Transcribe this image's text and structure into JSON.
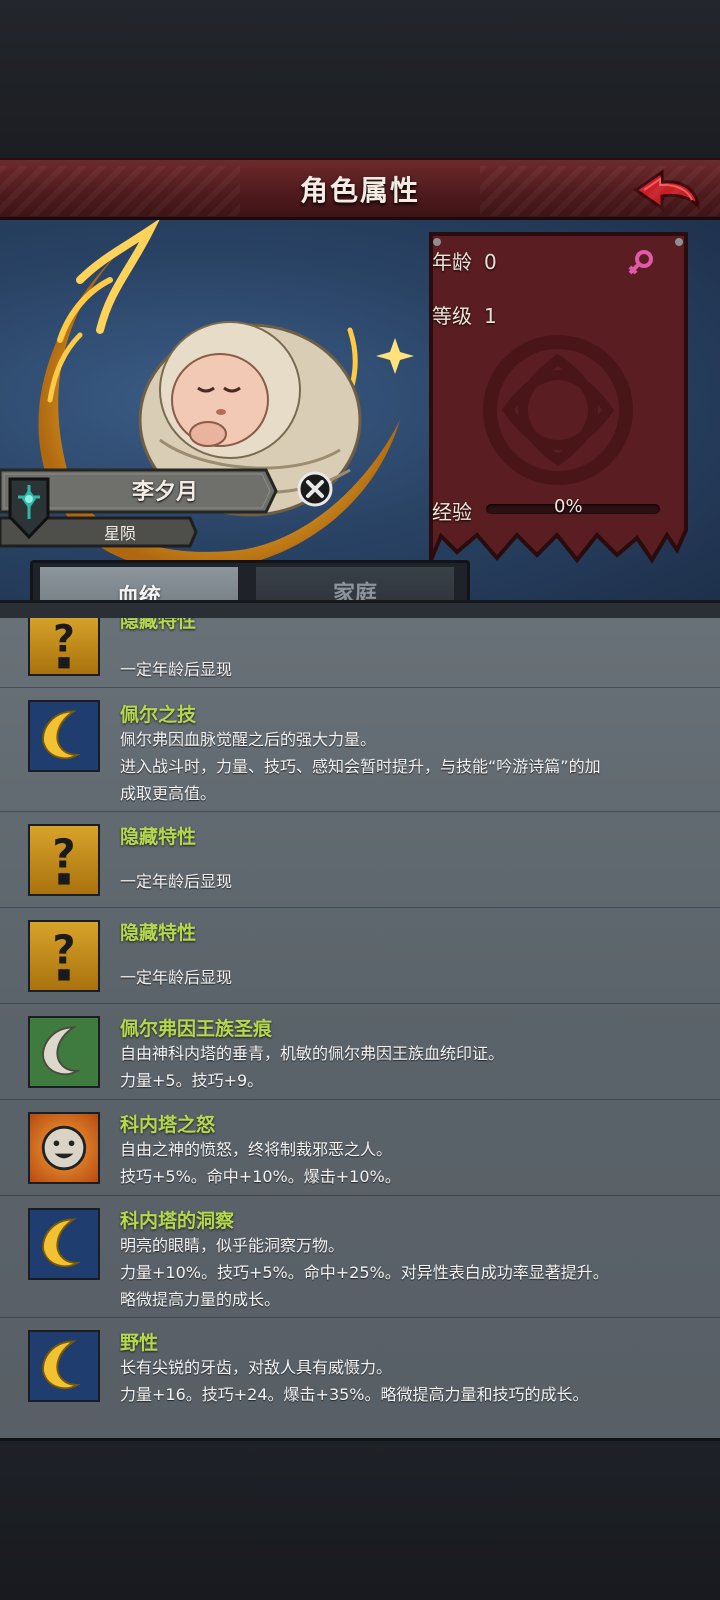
{
  "header": {
    "title": "角色属性"
  },
  "character": {
    "name": "李夕月",
    "title": "星陨",
    "age_label": "年龄",
    "age_value": "0",
    "level_label": "等级",
    "level_value": "1",
    "exp_label": "经验",
    "exp_value": "0%",
    "exp_fraction": 0.0
  },
  "tabs": [
    {
      "label": "血统",
      "active": true
    },
    {
      "label": "家庭",
      "active": false
    }
  ],
  "traits": [
    {
      "icon": "question-icon",
      "name": "隐藏特性",
      "lines": [
        "",
        "一定年龄后显现"
      ]
    },
    {
      "icon": "crescent-moon-icon",
      "name": "佩尔之技",
      "lines": [
        "佩尔弗因血脉觉醒之后的强大力量。",
        "进入战斗时，力量、技巧、感知会暂时提升，与技能“吟游诗篇”的加",
        "成取更高值。"
      ]
    },
    {
      "icon": "question-icon",
      "name": "隐藏特性",
      "lines": [
        "",
        "一定年龄后显现"
      ]
    },
    {
      "icon": "question-icon",
      "name": "隐藏特性",
      "lines": [
        "",
        "一定年龄后显现"
      ]
    },
    {
      "icon": "green-crescent-icon",
      "name": "佩尔弗因王族圣痕",
      "lines": [
        "自由神科内塔的垂青，机敏的佩尔弗因王族血统印证。",
        "力量+5。技巧+9。"
      ]
    },
    {
      "icon": "smiling-sun-icon",
      "name": "科内塔之怒",
      "lines": [
        "自由之神的愤怒，终将制裁邪恶之人。",
        "技巧+5%。命中+10%。爆击+10%。"
      ]
    },
    {
      "icon": "crescent-moon-icon",
      "name": "科内塔的洞察",
      "lines": [
        "明亮的眼睛，似乎能洞察万物。",
        "力量+10%。技巧+5%。命中+25%。对异性表白成功率显著提升。",
        "略微提高力量的成长。"
      ]
    },
    {
      "icon": "crescent-moon-icon",
      "name": "野性",
      "lines": [
        "长有尖锐的牙齿，对敌人具有威慑力。",
        "力量+16。技巧+24。爆击+35%。略微提高力量和技巧的成长。"
      ]
    }
  ]
}
